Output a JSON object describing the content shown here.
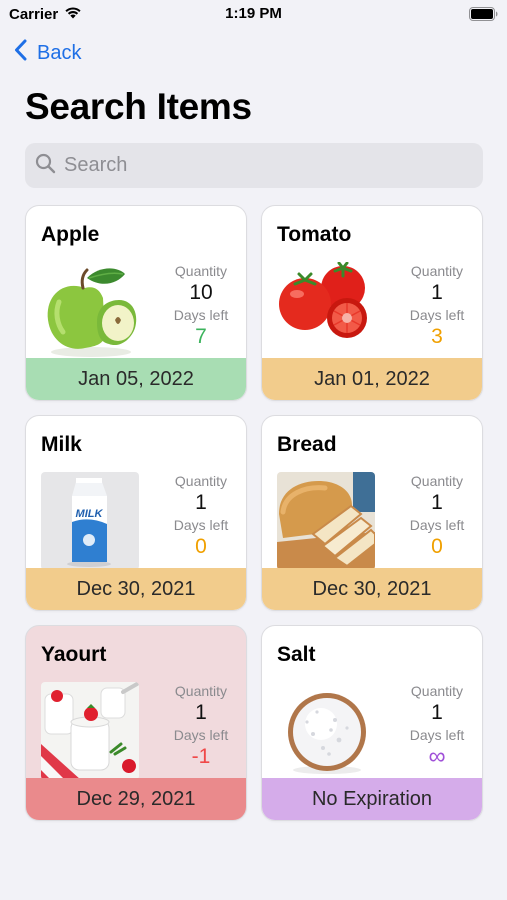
{
  "status_bar": {
    "carrier": "Carrier",
    "time": "1:19 PM"
  },
  "nav": {
    "back_label": "Back"
  },
  "page": {
    "title": "Search Items"
  },
  "search": {
    "placeholder": "Search",
    "value": ""
  },
  "colors": {
    "accent": "#1e6fe6",
    "good": "#3cb35c",
    "warning": "#f0a000",
    "expired": "#f04848",
    "none": "#a050d8",
    "footer_green": "#a8ddb3",
    "footer_orange": "#f2cc8c",
    "footer_red": "#ea8a8c",
    "footer_purple": "#d5acea"
  },
  "items": [
    {
      "name": "Apple",
      "qty_label": "Quantity",
      "qty": "10",
      "days_label": "Days left",
      "days": "7",
      "status": "good",
      "date": "Jan 05, 2022",
      "image_icon": "apple-image"
    },
    {
      "name": "Tomato",
      "qty_label": "Quantity",
      "qty": "1",
      "days_label": "Days left",
      "days": "3",
      "status": "warning",
      "date": "Jan 01, 2022",
      "image_icon": "tomato-image"
    },
    {
      "name": "Milk",
      "qty_label": "Quantity",
      "qty": "1",
      "days_label": "Days left",
      "days": "0",
      "status": "warning",
      "date": "Dec 30, 2021",
      "image_icon": "milk-carton-image",
      "carton_text": "MILK"
    },
    {
      "name": "Bread",
      "qty_label": "Quantity",
      "qty": "1",
      "days_label": "Days left",
      "days": "0",
      "status": "warning",
      "date": "Dec 30, 2021",
      "image_icon": "bread-image"
    },
    {
      "name": "Yaourt",
      "qty_label": "Quantity",
      "qty": "1",
      "days_label": "Days left",
      "days": "-1",
      "status": "expired",
      "date": "Dec 29, 2021",
      "image_icon": "yogurt-image"
    },
    {
      "name": "Salt",
      "qty_label": "Quantity",
      "qty": "1",
      "days_label": "Days left",
      "days": "∞",
      "status": "none",
      "date": "No Expiration",
      "image_icon": "salt-bowl-image"
    }
  ]
}
